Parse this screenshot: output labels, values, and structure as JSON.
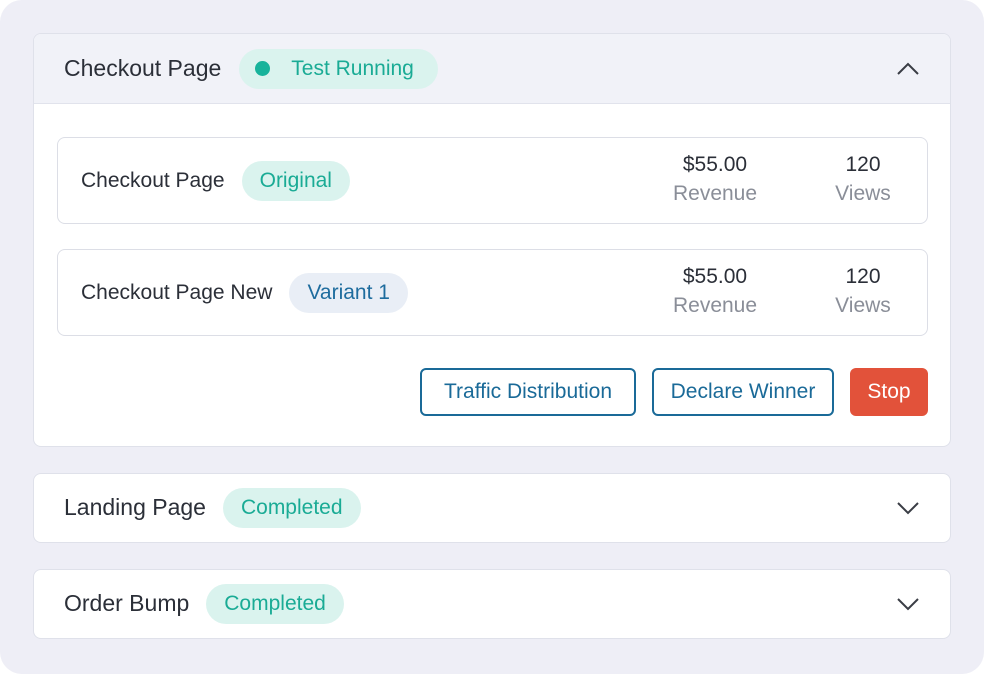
{
  "tests": [
    {
      "title": "Checkout Page",
      "status": "Test Running",
      "expanded": true,
      "variants": [
        {
          "name": "Checkout Page",
          "tag": "Original",
          "revenue": "$55.00",
          "revenue_label": "Revenue",
          "views": "120",
          "views_label": "Views"
        },
        {
          "name": "Checkout Page New",
          "tag": "Variant 1",
          "revenue": "$55.00",
          "revenue_label": "Revenue",
          "views": "120",
          "views_label": "Views"
        }
      ],
      "actions": {
        "traffic": "Traffic Distribution",
        "declare": "Declare Winner",
        "stop": "Stop"
      }
    },
    {
      "title": "Landing Page",
      "status": "Completed",
      "expanded": false
    },
    {
      "title": "Order Bump",
      "status": "Completed",
      "expanded": false
    }
  ],
  "icons": {
    "collapse": "chevron-up-icon",
    "expand": "chevron-down-icon",
    "status": "status-dot-icon"
  },
  "colors": {
    "accent_green": "#1aab95",
    "accent_blue": "#1a6a98",
    "stop_red": "#e2523a",
    "background": "#eeeef6"
  }
}
